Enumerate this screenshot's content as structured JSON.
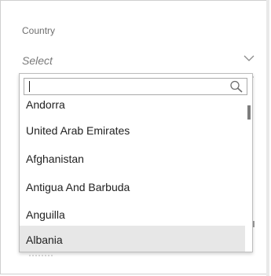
{
  "field": {
    "label": "Country",
    "selected_display": "Select",
    "chevron_icon": "chevron-down-icon"
  },
  "search": {
    "value": "",
    "placeholder": "",
    "icon": "search-icon"
  },
  "options": [
    {
      "label": "Andorra"
    },
    {
      "label": "United Arab Emirates"
    },
    {
      "label": "Afghanistan"
    },
    {
      "label": "Antigua And Barbuda"
    },
    {
      "label": "Anguilla"
    },
    {
      "label": "Albania"
    }
  ],
  "scroll": {
    "position_fraction": 0.05
  },
  "colors": {
    "highlight": "#e7e7e7",
    "text": "#222222",
    "label": "#6f6f6f"
  }
}
